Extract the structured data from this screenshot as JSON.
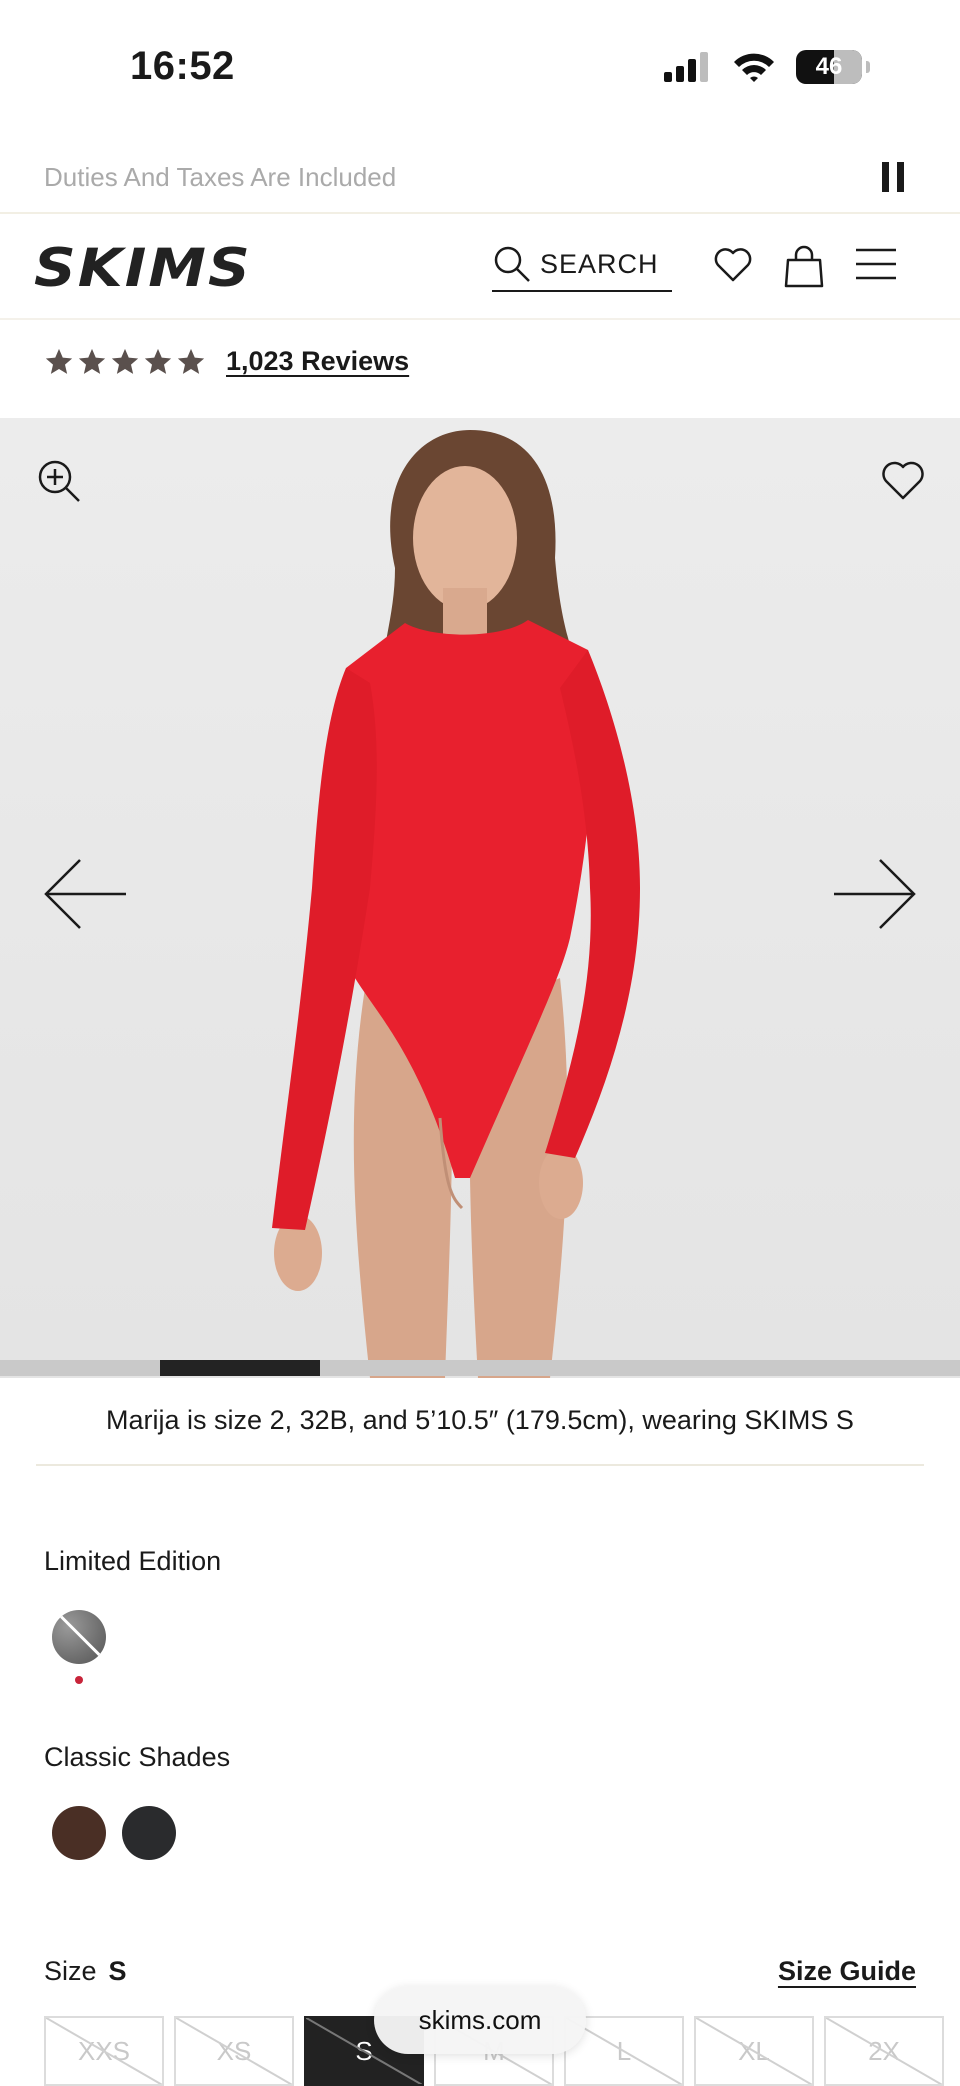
{
  "status_bar": {
    "time": "16:52",
    "battery": "46"
  },
  "announcement": {
    "text": "Duties And Taxes Are Included"
  },
  "header": {
    "logo": "SKIMS",
    "search_label": "SEARCH"
  },
  "reviews": {
    "rating": 5,
    "count_label": "1,023 Reviews"
  },
  "gallery": {
    "progress": 0.1667
  },
  "model_info": "Marija is size 2, 32B, and 5’10.5″ (179.5cm), wearing SKIMS S",
  "colors": {
    "limited_label": "Limited Edition",
    "classic_label": "Classic Shades",
    "limited_swatch": "#7a7a7a",
    "classic_swatches": [
      "#4a2f25",
      "#2a2b2d"
    ],
    "product_red": "#e8202e"
  },
  "size": {
    "label": "Size",
    "selected": "S",
    "guide_label": "Size Guide",
    "options": [
      "XXS",
      "XS",
      "S",
      "M",
      "L",
      "XL",
      "2X"
    ]
  },
  "browser": {
    "url": "skims.com"
  }
}
